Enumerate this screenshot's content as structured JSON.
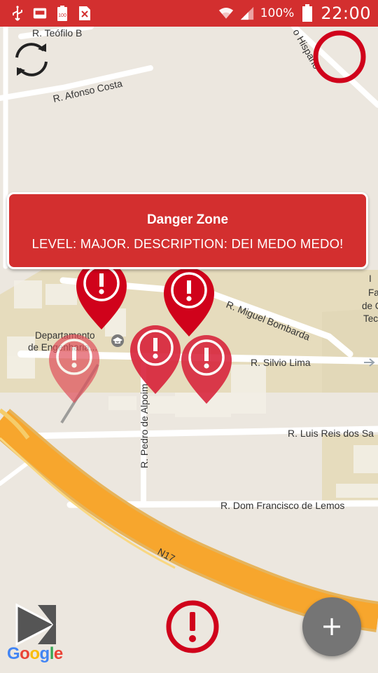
{
  "status_bar": {
    "battery_percent": "100%",
    "time": "22:00",
    "icons": [
      "usb-icon",
      "sim-icon",
      "battery-saver-icon",
      "no-sim-icon",
      "wifi-icon",
      "signal-icon",
      "battery-icon"
    ]
  },
  "map": {
    "road_labels": {
      "teofilo": "R. Teófilo B",
      "hispano": "o Hispano",
      "afonso_costa": "R. Afonso Costa",
      "miguel_bombarda": "R. Miguel Bombarda",
      "silvio_lima": "R. Silvio Lima",
      "pedro_alpoim": "R. Pedro de Alpoim",
      "luis_reis": "R. Luis Reis dos Sa",
      "dom_francisco": "R. Dom Francisco de Lemos",
      "n17": "N17"
    },
    "poi_labels": {
      "dept_line1": "Departamento",
      "dept_line2": "de Engenharia...",
      "right_fa": "Fa",
      "right_de": "de C",
      "right_tec": "Tec",
      "right_i": "I"
    },
    "colors": {
      "land": "#ece7df",
      "building": "#e8ddbf",
      "highway": "#f7a62d",
      "highway_edge": "#f5d27a",
      "road": "#ffffff"
    }
  },
  "info_window": {
    "title": "Danger Zone",
    "description": "LEVEL: MAJOR. DESCRIPTION: DEI MEDO MEDO!"
  },
  "markers": {
    "icon": "danger-marker-icon",
    "color": "#d0021b",
    "count": 5,
    "dragging": 1
  },
  "controls": {
    "refresh_icon": "refresh-icon",
    "add_label": "+",
    "report_icon": "alert-icon",
    "navigation_icon": "navigation-arrow-icon",
    "ring_icon": "circle-ring-icon"
  },
  "attribution": {
    "google": "Google"
  },
  "accent": "#d32f2f"
}
